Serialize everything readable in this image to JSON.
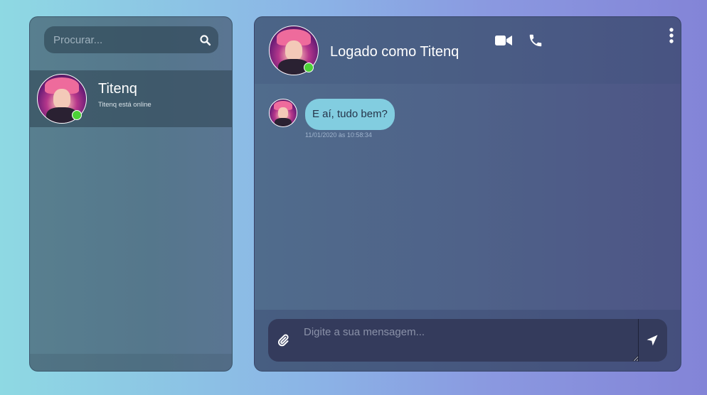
{
  "sidebar": {
    "search": {
      "placeholder": "Procurar...",
      "icon": "search-icon"
    },
    "contacts": [
      {
        "name": "Titenq",
        "status": "Titenq está online",
        "online": true
      }
    ]
  },
  "chat": {
    "header": {
      "title": "Logado como Titenq",
      "online": true,
      "actions": [
        "video-camera-icon",
        "phone-icon",
        "more-vertical-icon"
      ]
    },
    "messages": [
      {
        "text": "E aí, tudo bem?",
        "timestamp": "11/01/2020 às 10:58:34"
      }
    ],
    "composer": {
      "placeholder": "Digite a sua mensagem...",
      "attach_icon": "paperclip-icon",
      "send_icon": "send-arrow-icon"
    }
  },
  "colors": {
    "online": "#4cd137",
    "bubble": "#82cde0",
    "composer": "#343b5c"
  }
}
